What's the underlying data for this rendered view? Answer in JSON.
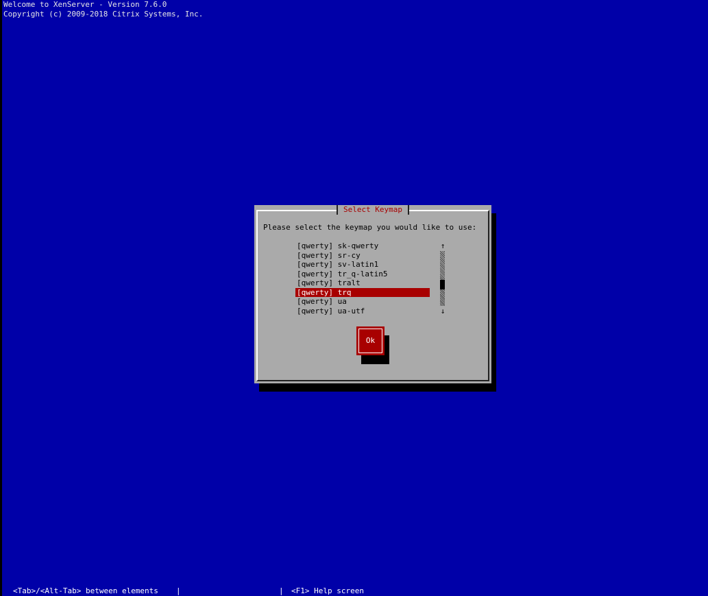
{
  "header": {
    "line1": "Welcome to XenServer - Version 7.6.0",
    "line2": "Copyright (c) 2009-2018 Citrix Systems, Inc."
  },
  "dialog": {
    "title": "Select Keymap",
    "prompt": "Please select the keymap you would like to use:",
    "items": [
      {
        "label": "[qwerty] sk-qwerty"
      },
      {
        "label": "[qwerty] sr-cy"
      },
      {
        "label": "[qwerty] sv-latin1"
      },
      {
        "label": "[qwerty] tr_q-latin5"
      },
      {
        "label": "[qwerty] tralt"
      },
      {
        "label": "[qwerty] trq"
      },
      {
        "label": "[qwerty] ua"
      },
      {
        "label": "[qwerty] ua-utf"
      }
    ],
    "selected_index": 5,
    "scroll_up_glyph": "↑",
    "scroll_down_glyph": "↓",
    "ok_label": "Ok"
  },
  "footer": {
    "hint1": "<Tab>/<Alt-Tab> between elements",
    "separator": "|",
    "hint2": "<F1> Help screen"
  },
  "colors": {
    "background": "#0000a8",
    "dialog": "#aaaaaa",
    "accent": "#a80000",
    "shadow": "#000000"
  }
}
